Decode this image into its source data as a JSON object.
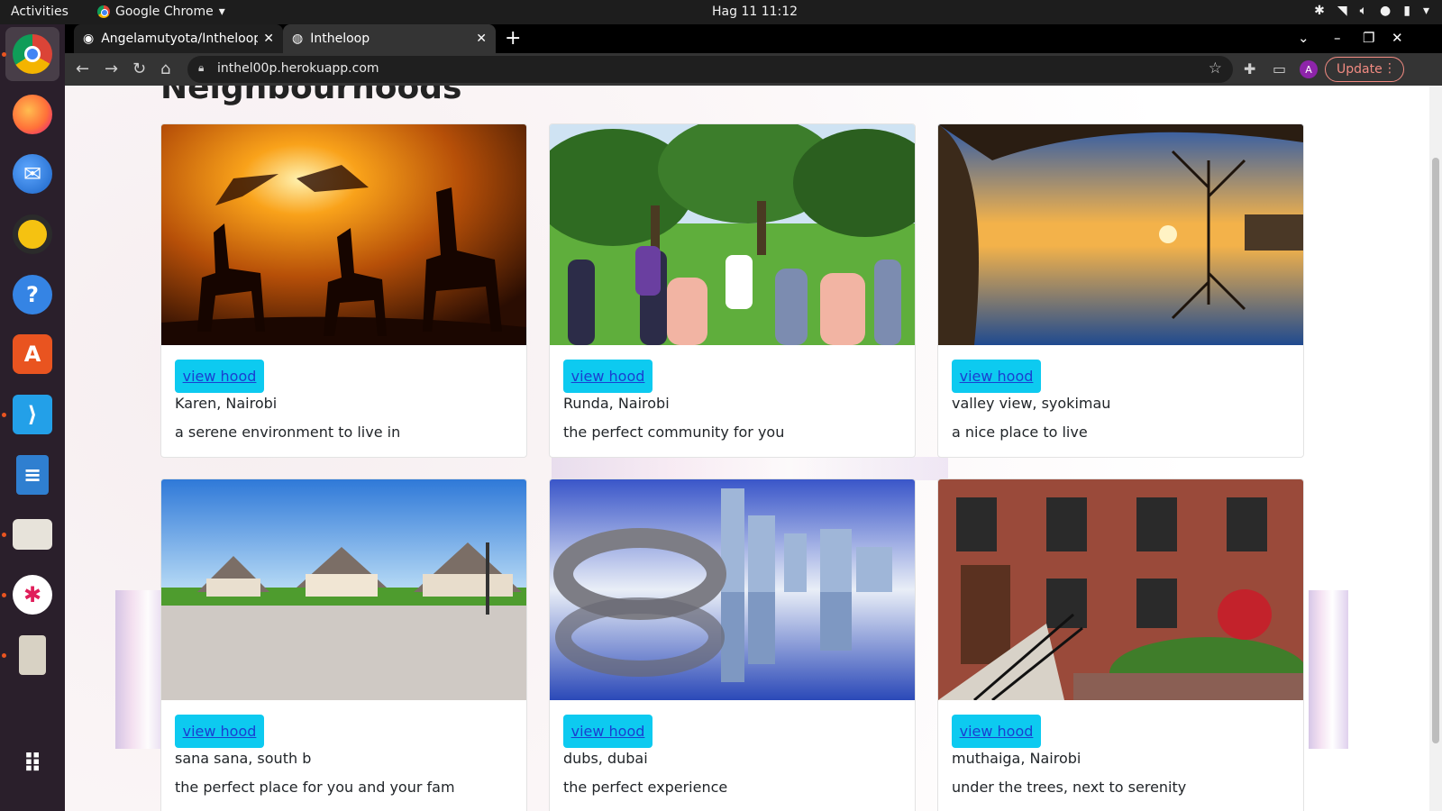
{
  "topbar": {
    "activities": "Activities",
    "app_name": "Google Chrome",
    "datetime": "Hag 11  11:12"
  },
  "browser": {
    "tabs": [
      {
        "title": "Angelamutyota/Intheloop"
      },
      {
        "title": "Intheloop"
      }
    ],
    "url": "inthel00p.herokuapp.com",
    "profile_initial": "A",
    "update_label": "Update"
  },
  "dock": {
    "apps": [
      "chrome-icon",
      "firefox-icon",
      "thunderbird-icon",
      "rhythmbox-icon",
      "help-icon",
      "software-icon",
      "vscode-icon",
      "writer-icon",
      "files-icon",
      "slack-icon",
      "archive-icon",
      "app-grid-icon"
    ]
  },
  "page": {
    "heading": "Neighbourhoods",
    "cards": [
      {
        "button": "view hood",
        "name": "Karen, Nairobi",
        "description": "a serene environment to live in"
      },
      {
        "button": "view hood",
        "name": "Runda, Nairobi",
        "description": "the perfect community for you"
      },
      {
        "button": "view hood",
        "name": "valley view, syokimau",
        "description": "a nice place to live"
      },
      {
        "button": "view hood",
        "name": "sana sana, south b",
        "description": "the perfect place for you and your fam"
      },
      {
        "button": "view hood",
        "name": "dubs, dubai",
        "description": "the perfect experience"
      },
      {
        "button": "view hood",
        "name": "muthaiga, Nairobi",
        "description": "under the trees, next to serenity"
      }
    ]
  }
}
